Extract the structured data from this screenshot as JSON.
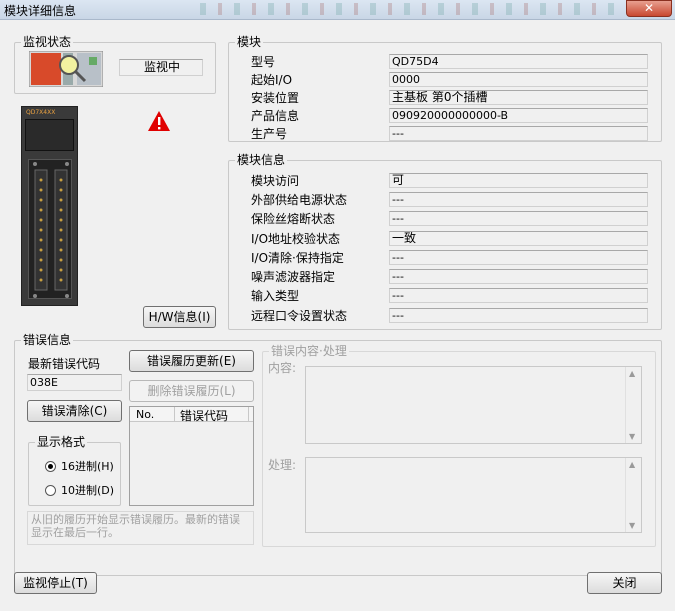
{
  "window": {
    "title": "模块详细信息",
    "close_glyph": "✕"
  },
  "monitor": {
    "legend": "监视状态",
    "status": "监视中"
  },
  "module_image": {
    "label": "QD7X4XX"
  },
  "hw_button": "H/W信息(I)",
  "module": {
    "legend": "模块",
    "rows": [
      {
        "label": "型号",
        "value": "QD75D4"
      },
      {
        "label": "起始I/O",
        "value": "0000"
      },
      {
        "label": "安装位置",
        "value": "主基板    第0个插槽"
      },
      {
        "label": "产品信息",
        "value": "090920000000000-B"
      },
      {
        "label": "生产号",
        "value": "---"
      }
    ]
  },
  "module_info": {
    "legend": "模块信息",
    "rows": [
      {
        "label": "模块访问",
        "value": "可"
      },
      {
        "label": "外部供给电源状态",
        "value": "---"
      },
      {
        "label": "保险丝熔断状态",
        "value": "---"
      },
      {
        "label": "I/O地址校验状态",
        "value": "一致"
      },
      {
        "label": "I/O清除·保持指定",
        "value": "---"
      },
      {
        "label": "噪声滤波器指定",
        "value": "---"
      },
      {
        "label": "输入类型",
        "value": "---"
      },
      {
        "label": "远程口令设置状态",
        "value": "---"
      }
    ]
  },
  "error_info": {
    "legend": "错误信息",
    "latest_label": "最新错误代码",
    "latest_value": "038E",
    "history_update_button": "错误履历更新(E)",
    "history_delete_button": "删除错误履历(L)",
    "clear_button": "错误清除(C)",
    "table_headers": [
      "No.",
      "错误代码"
    ],
    "display_format_legend": "显示格式",
    "hex_option": "16进制(H)",
    "dec_option": "10进制(D)",
    "note": "从旧的履历开始显示错误履历。最新的错误显示在最后一行。",
    "detail_legend": "错误内容·处理",
    "content_label": "内容:",
    "action_label": "处理:"
  },
  "footer": {
    "stop_button": "监视停止(T)",
    "close_button": "关闭"
  },
  "colors": {
    "warning": "#e00000",
    "module_body": "#3a3a3a"
  }
}
